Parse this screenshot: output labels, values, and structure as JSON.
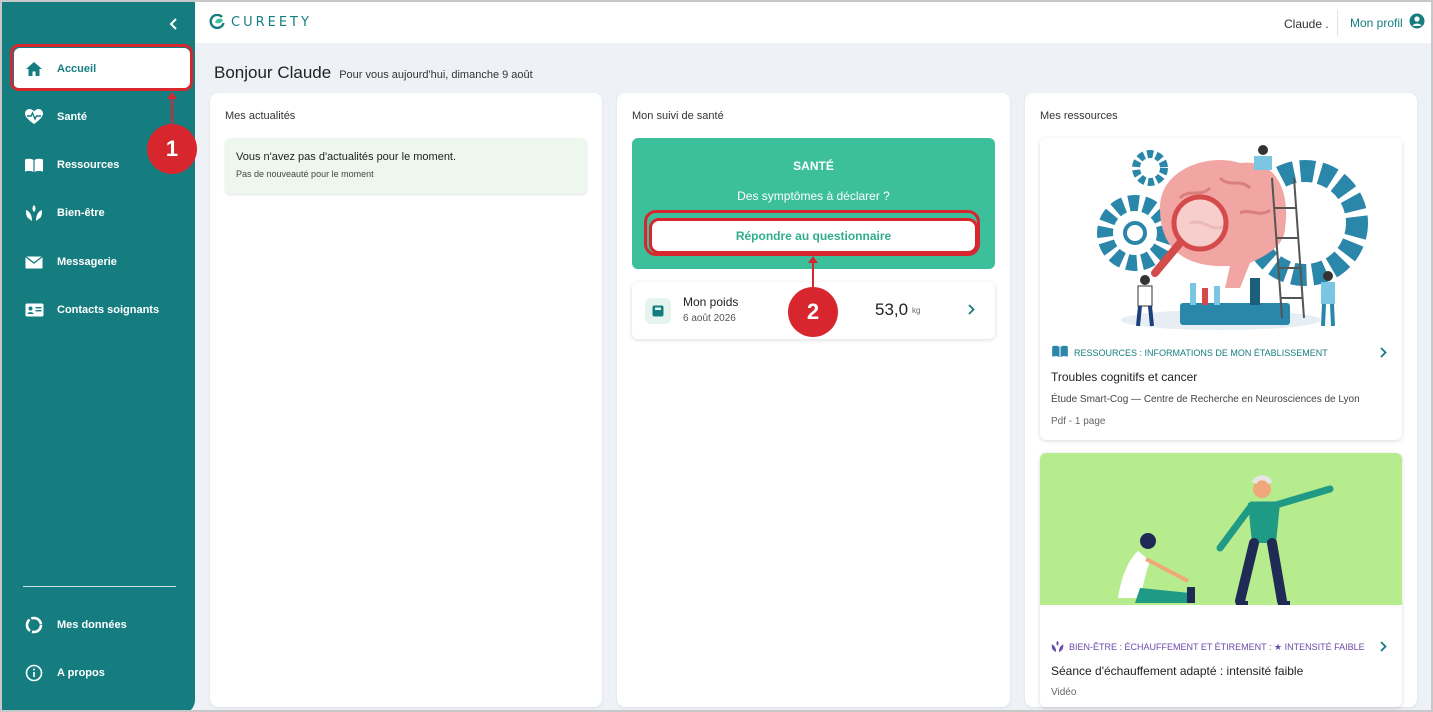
{
  "app": {
    "brand": "CUREETY",
    "accent": "#157d80",
    "annotation_color": "#d8262e"
  },
  "sidebar": {
    "items": [
      {
        "label": "Accueil",
        "icon": "home-icon",
        "active": true
      },
      {
        "label": "Santé",
        "icon": "heart-pulse-icon"
      },
      {
        "label": "Ressources",
        "icon": "book-icon"
      },
      {
        "label": "Bien-être",
        "icon": "lotus-hands-icon"
      },
      {
        "label": "Messagerie",
        "icon": "envelope-icon"
      },
      {
        "label": "Contacts soignants",
        "icon": "contact-card-icon"
      }
    ],
    "bottom_items": [
      {
        "label": "Mes données",
        "icon": "circle-data-icon"
      },
      {
        "label": "A propos",
        "icon": "info-icon"
      }
    ]
  },
  "header": {
    "user_name": "Claude .",
    "profile_label": "Mon profil"
  },
  "greeting": {
    "title": "Bonjour Claude",
    "subtitle": "Pour vous aujourd'hui, dimanche 9 août"
  },
  "news": {
    "title": "Mes actualités",
    "empty_title": "Vous n'avez pas d'actualités pour le moment.",
    "empty_sub": "Pas de nouveauté pour le moment"
  },
  "health": {
    "title": "Mon suivi de santé",
    "box_title": "SANTÉ",
    "question": "Des symptômes à déclarer ?",
    "button_label": "Répondre au questionnaire",
    "weight": {
      "label": "Mon poids",
      "date": "6 août 2026",
      "value": "53,0",
      "unit": "kg"
    }
  },
  "resources": {
    "title": "Mes ressources",
    "items": [
      {
        "category": "RESSOURCES : INFORMATIONS DE MON ÉTABLISSEMENT",
        "category_color": "#157d80",
        "title": "Troubles cognitifs et cancer",
        "description": "Étude Smart-Cog — Centre de Recherche en Neurosciences de Lyon",
        "meta": "Pdf - 1 page"
      },
      {
        "category": "BIEN-ÊTRE : ÉCHAUFFEMENT ET ÉTIREMENT : ★ INTENSITÉ FAIBLE",
        "category_color": "#6a4aa8",
        "title": "Séance d'échauffement adapté : intensité faible",
        "meta": "Vidéo"
      }
    ]
  },
  "annotations": {
    "step1": "1",
    "step2": "2"
  }
}
